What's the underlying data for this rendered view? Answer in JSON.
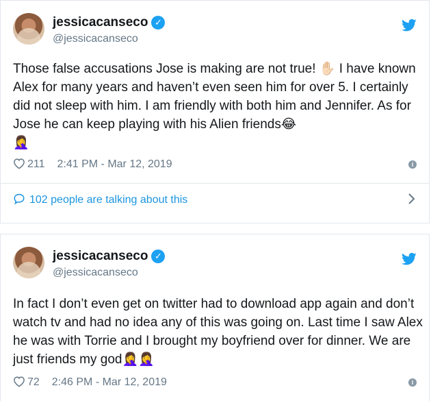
{
  "tweets": [
    {
      "name": "jessicacanseco",
      "handle": "@jessicacanseco",
      "text_parts": [
        "Those false accusations Jose is making are not true! ",
        " I have known Alex for many years and haven’t even seen him for over 5. I certainly did not sleep with him. I am friendly with both him and Jennifer. As for Jose he can keep playing with his Alien friends",
        ""
      ],
      "emojis": [
        "✋🏻",
        "😂",
        "🤦‍♀️"
      ],
      "likes": "211",
      "timestamp": "2:41 PM - Mar 12, 2019",
      "talking": "102 people are talking about this"
    },
    {
      "name": "jessicacanseco",
      "handle": "@jessicacanseco",
      "text": "In fact I don’t even get on twitter had to download app again and don’t watch tv and had no idea any of this was going on.  Last time I saw Alex he was with Torrie and I brought my boyfriend over for dinner. We are just friends my god",
      "emojis": [
        "🤦‍♀️",
        "🤦‍♀️"
      ],
      "likes": "72",
      "timestamp": "2:46 PM - Mar 12, 2019"
    }
  ],
  "colors": {
    "accent": "#1da1f2",
    "link": "#1b95e0",
    "muted": "#657786",
    "border": "#e1e8ed"
  },
  "icons": [
    "verified-badge-icon",
    "twitter-bird-icon",
    "heart-icon",
    "info-icon",
    "speech-bubble-icon",
    "chevron-right-icon"
  ]
}
